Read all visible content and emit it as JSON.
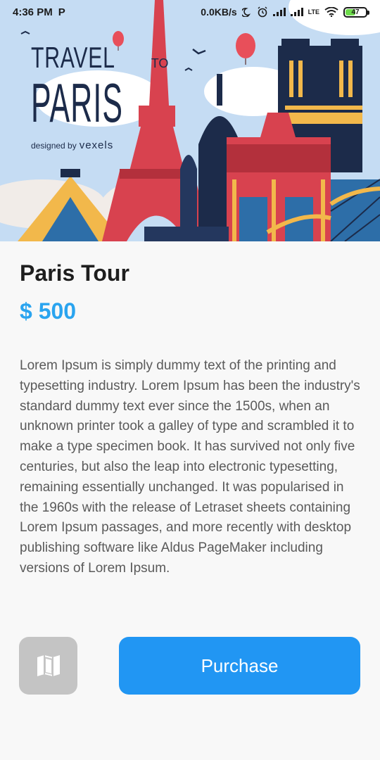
{
  "status_bar": {
    "time": "4:36 PM",
    "app_badge": "P",
    "speed": "0.0KB/s",
    "network_label": "LTE",
    "battery": "47"
  },
  "hero": {
    "title_travel": "TRAVEL",
    "title_to": "TO",
    "title_city": "PARIS",
    "credit_label": "designed by",
    "credit_brand": "vexels"
  },
  "tour": {
    "title": "Paris Tour",
    "price": "$ 500",
    "description": "Lorem Ipsum is simply dummy text of the printing and typesetting industry. Lorem Ipsum has been the industry's standard dummy text ever since the 1500s, when an unknown printer took a galley of type and scrambled it to make a type specimen book. It has survived not only five centuries, but also the leap into electronic typesetting, remaining essentially unchanged. It was popularised in the 1960s with the release of Letraset sheets containing Lorem Ipsum passages, and more recently with desktop publishing software like Aldus PageMaker including versions of Lorem Ipsum."
  },
  "actions": {
    "map_icon": "map-icon",
    "purchase_label": "Purchase"
  },
  "colors": {
    "accent": "#2aa4ef",
    "purchase_button": "#2196f3",
    "map_button": "#c4c4c4",
    "sky": "#c5dcf3"
  }
}
